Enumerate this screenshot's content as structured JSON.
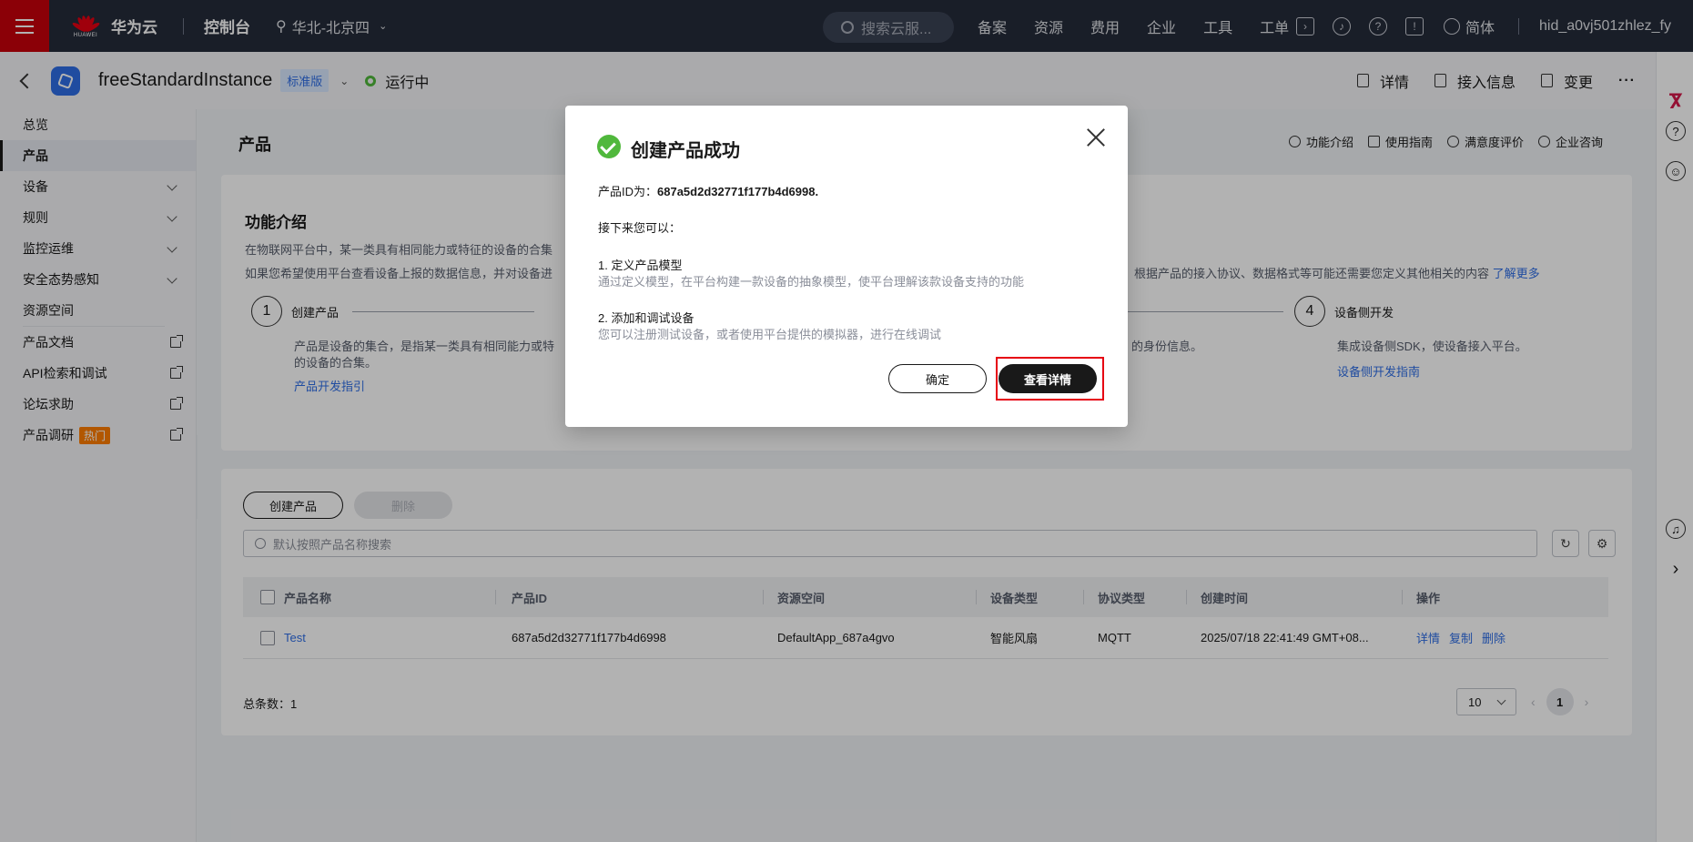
{
  "topbar": {
    "brand_mark": "HUAWEI",
    "brand": "华为云",
    "console": "控制台",
    "region": "华北-北京四",
    "search_placeholder": "搜索云服...",
    "nav": [
      "备案",
      "资源",
      "费用",
      "企业",
      "工具",
      "工单"
    ],
    "lang": "简体",
    "user": "hid_a0vj501zhlez_fy"
  },
  "instance": {
    "name": "freeStandardInstance",
    "edition": "标准版",
    "status": "运行中",
    "actions": [
      "详情",
      "接入信息",
      "变更"
    ],
    "more": "···"
  },
  "sidebar": {
    "items": [
      {
        "label": "总览"
      },
      {
        "label": "产品"
      },
      {
        "label": "设备"
      },
      {
        "label": "规则"
      },
      {
        "label": "监控运维"
      },
      {
        "label": "安全态势感知"
      },
      {
        "label": "资源空间"
      },
      {
        "label": "产品文档"
      },
      {
        "label": "API检索和调试"
      },
      {
        "label": "论坛求助"
      },
      {
        "label": "产品调研"
      }
    ],
    "hot_badge": "热门"
  },
  "page": {
    "title": "产品",
    "help_links": [
      "功能介绍",
      "使用指南",
      "满意度评价",
      "企业咨询"
    ]
  },
  "intro": {
    "title": "功能介绍",
    "line1": "在物联网平台中，某一类具有相同能力或特征的设备的合集",
    "line2_left": "如果您希望使用平台查看设备上报的数据信息，并对设备进",
    "line2_right": "根据产品的接入协议、数据格式等可能还需要您定义其他相关的内容",
    "learn_more": "了解更多",
    "steps": [
      {
        "num": "1",
        "label": "创建产品",
        "desc1": "产品是设备的集合，是指某一类具有相同能力或特",
        "desc2": "的设备的合集。",
        "link": "产品开发指引"
      },
      {
        "num": "4",
        "label": "设备侧开发",
        "desc1": "集成设备侧SDK，使设备接入平台。",
        "link": "设备侧开发指南"
      }
    ],
    "step3_tail": "的身份信息。"
  },
  "products": {
    "create_btn": "创建产品",
    "delete_btn": "删除",
    "search_placeholder": "默认按照产品名称搜索",
    "columns": [
      "产品名称",
      "产品ID",
      "资源空间",
      "设备类型",
      "协议类型",
      "创建时间",
      "操作"
    ],
    "rows": [
      {
        "name": "Test",
        "id": "687a5d2d32771f177b4d6998",
        "space": "DefaultApp_687a4gvo",
        "device_type": "智能风扇",
        "protocol": "MQTT",
        "created": "2025/07/18 22:41:49 GMT+08...",
        "ops": [
          "详情",
          "复制",
          "删除"
        ]
      }
    ],
    "total_label": "总条数：1",
    "page_size": "10",
    "current_page": "1"
  },
  "dialog": {
    "title": "创建产品成功",
    "id_prefix": "产品ID为：",
    "id_value": "687a5d2d32771f177b4d6998.",
    "next": "接下来您可以：",
    "step1_title": "1. 定义产品模型",
    "step1_desc": "通过定义模型，在平台构建一款设备的抽象模型，使平台理解该款设备支持的功能",
    "step2_title": "2. 添加和调试设备",
    "step2_desc": "您可以注册测试设备，或者使用平台提供的模拟器，进行在线调试",
    "ok": "确定",
    "detail": "查看详情"
  },
  "colors": {
    "topbar": "#252b3a",
    "brand_red": "#c7000b",
    "link": "#2e6ee6",
    "success": "#50b83c",
    "highlight": "#e60012"
  }
}
